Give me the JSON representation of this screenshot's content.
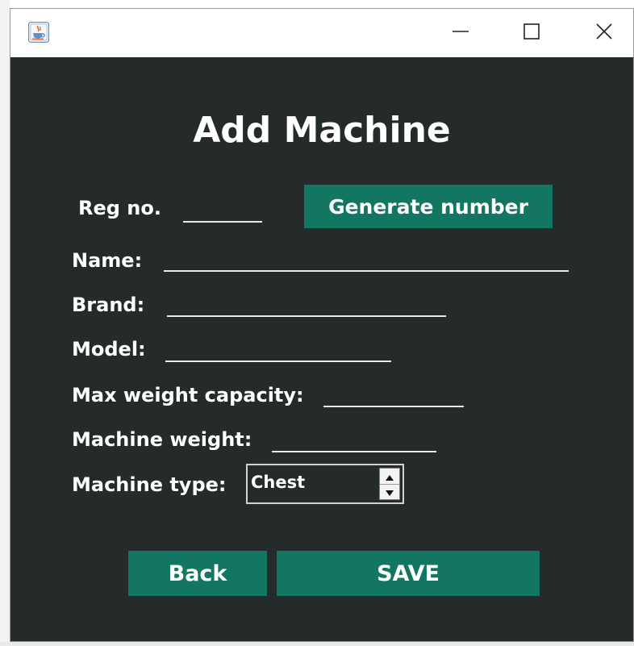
{
  "window": {
    "app_icon": "java-coffee-cup-icon",
    "controls": {
      "minimize_icon": "minimize-icon",
      "maximize_icon": "maximize-icon",
      "close_icon": "close-icon"
    }
  },
  "form": {
    "title": "Add Machine",
    "reg_no_label": "Reg no.",
    "generate_button": "Generate number",
    "name_label": "Name:",
    "name_value": "",
    "brand_label": "Brand:",
    "brand_value": "",
    "model_label": "Model:",
    "model_value": "",
    "max_weight_label": "Max weight capacity:",
    "max_weight_value": "",
    "machine_weight_label": "Machine weight:",
    "machine_weight_value": "",
    "machine_type_label": "Machine type:",
    "machine_type_value": "Chest"
  },
  "actions": {
    "back_label": "Back",
    "save_label": "SAVE"
  },
  "colors": {
    "background": "#252b2b",
    "button": "#137663",
    "text": "#ffffff"
  }
}
